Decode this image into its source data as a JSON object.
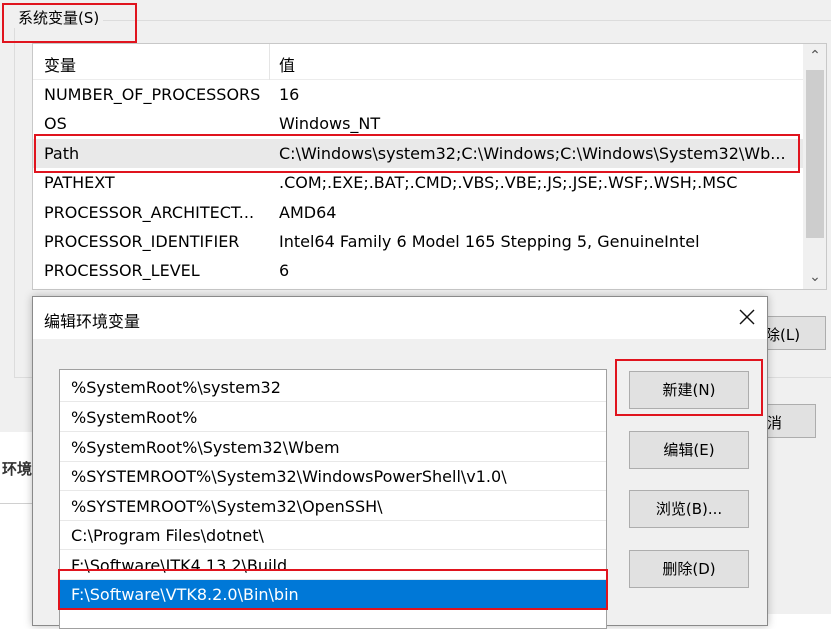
{
  "system_vars": {
    "group_title": "系统变量(S)",
    "header_name": "变量",
    "header_value": "值",
    "rows": [
      {
        "name": "NUMBER_OF_PROCESSORS",
        "value": "16"
      },
      {
        "name": "OS",
        "value": "Windows_NT"
      },
      {
        "name": "Path",
        "value": "C:\\Windows\\system32;C:\\Windows;C:\\Windows\\System32\\Wb..."
      },
      {
        "name": "PATHEXT",
        "value": ".COM;.EXE;.BAT;.CMD;.VBS;.VBE;.JS;.JSE;.WSF;.WSH;.MSC"
      },
      {
        "name": "PROCESSOR_ARCHITECT...",
        "value": "AMD64"
      },
      {
        "name": "PROCESSOR_IDENTIFIER",
        "value": "Intel64 Family 6 Model 165 Stepping 5, GenuineIntel"
      },
      {
        "name": "PROCESSOR_LEVEL",
        "value": "6"
      }
    ],
    "selected_row": "Path",
    "partial_button_1": "除(L)",
    "partial_button_2": "消",
    "cut_text": "环境"
  },
  "dialog": {
    "title": "编辑环境变量",
    "paths": [
      "%SystemRoot%\\system32",
      "%SystemRoot%",
      "%SystemRoot%\\System32\\Wbem",
      "%SYSTEMROOT%\\System32\\WindowsPowerShell\\v1.0\\",
      "%SYSTEMROOT%\\System32\\OpenSSH\\",
      "C:\\Program Files\\dotnet\\",
      "F:\\Software\\ITK4.13.2\\Build",
      "F:\\Software\\VTK8.2.0\\Bin\\bin"
    ],
    "selected_path": "F:\\Software\\VTK8.2.0\\Bin\\bin",
    "buttons": {
      "new": "新建(N)",
      "edit": "编辑(E)",
      "browse": "浏览(B)...",
      "delete": "删除(D)"
    }
  },
  "colors": {
    "highlight_box": "#e0141e",
    "selection": "#0078d7"
  },
  "icons": [
    "close-icon",
    "scroll-up-icon",
    "scroll-down-icon"
  ]
}
